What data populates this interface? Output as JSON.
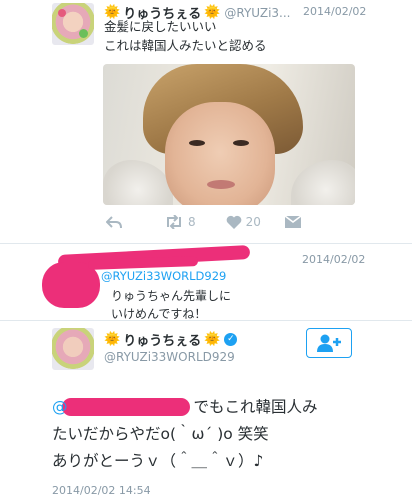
{
  "tweet1": {
    "name_emoji": "🌞",
    "display_name": "りゅうちぇる",
    "handle": "@RYUZi3...",
    "date": "2014/02/02",
    "text_line1": "金髪に戻したいいい",
    "text_line2": "これは韓国人みたいと認める",
    "actions": {
      "retweets": "8",
      "likes": "20"
    }
  },
  "reply": {
    "date": "2014/02/02",
    "mention": "@RYUZi33WORLD929",
    "text_line1": "りゅうちゃん先輩しに",
    "text_line2": "いけめんですね！"
  },
  "tweet3": {
    "name_emoji": "🌞",
    "display_name": "りゅうちぇる",
    "verified_mark": "✓",
    "handle": "@RYUZi33WORLD929",
    "mention_prefix": "@",
    "text_after_mention": "でもこれ韓国人み",
    "text_line2": "たいだからやだo(｀ω´ )o 笑笑",
    "text_line3": "ありがとーうｖ（＾＿＾ｖ）♪",
    "timestamp": "2014/02/02 14:54"
  },
  "colors": {
    "accent": "#1da1f2",
    "redaction": "#ec2f79",
    "muted": "#8899a6",
    "icon": "#aab8c2"
  }
}
